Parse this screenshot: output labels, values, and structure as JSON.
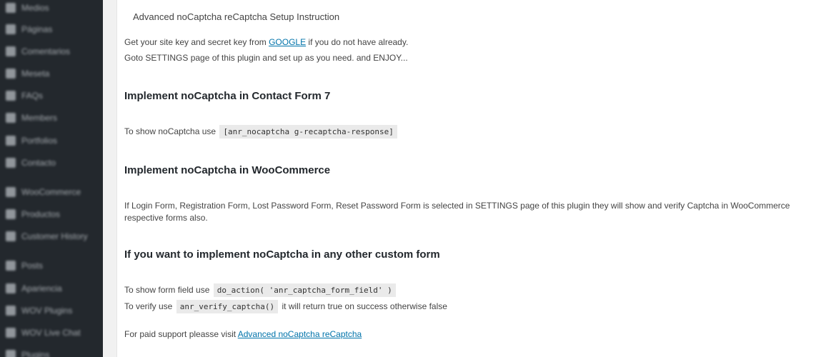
{
  "sidebar": {
    "items": [
      {
        "label": "Medios",
        "icon": "media-icon"
      },
      {
        "label": "Páginas",
        "icon": "pages-icon"
      },
      {
        "label": "Comentarios",
        "icon": "comments-icon"
      },
      {
        "label": "Meseta",
        "icon": "portfolio-icon"
      },
      {
        "label": "FAQs",
        "icon": "faq-icon"
      },
      {
        "label": "Members",
        "icon": "members-icon"
      },
      {
        "label": "Portfolios",
        "icon": "portfolio-icon"
      },
      {
        "label": "Contacto",
        "icon": "contact-icon"
      },
      {
        "label": "WooCommerce",
        "icon": "woocommerce-icon"
      },
      {
        "label": "Productos",
        "icon": "products-icon"
      },
      {
        "label": "Customer History",
        "icon": "history-icon"
      },
      {
        "label": "Posts",
        "icon": "posts-icon"
      },
      {
        "label": "Apariencia",
        "icon": "appearance-icon"
      },
      {
        "label": "WOV Plugins",
        "icon": "plugins-icon"
      },
      {
        "label": "WOV Live Chat",
        "icon": "chat-icon"
      },
      {
        "label": "Plugins",
        "icon": "plugins-icon"
      }
    ]
  },
  "content": {
    "section_title": "Advanced noCaptcha reCaptcha Setup Instruction",
    "intro_pre": "Get your site key and secret key from ",
    "intro_link": "GOOGLE",
    "intro_post": " if you do not have already.",
    "intro_line2": "Goto SETTINGS page of this plugin and set up as you need. and ENJOY...",
    "cf7_heading": "Implement noCaptcha in Contact Form 7",
    "cf7_text": "To show noCaptcha use",
    "cf7_code": "[anr_nocaptcha g-recaptcha-response]",
    "woo_heading": "Implement noCaptcha in WooCommerce",
    "woo_text": "If Login Form, Registration Form, Lost Password Form, Reset Password Form is selected in SETTINGS page of this plugin they will show and verify Captcha in WooCommerce respective forms also.",
    "custom_heading": "If you want to implement noCaptcha in any other custom form",
    "custom_show_text": "To show form field use",
    "custom_show_code": "do_action( 'anr_captcha_form_field' )",
    "custom_verify_text": "To verify use",
    "custom_verify_code": "anr_verify_captcha()",
    "custom_verify_post": "it will return true on success otherwise false",
    "support_pre": "For paid support pleasse visit ",
    "support_link": "Advanced noCaptcha reCaptcha"
  },
  "colors": {
    "sidebar_bg": "#23282d",
    "link": "#0073aa",
    "panel_bg": "#ffffff",
    "page_bg": "#f1f1f1"
  }
}
